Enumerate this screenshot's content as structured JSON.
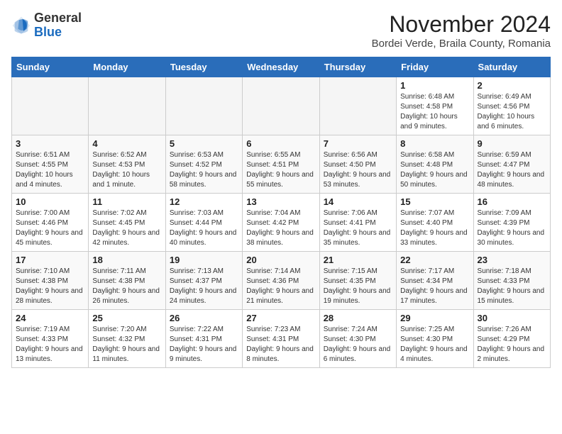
{
  "logo": {
    "general": "General",
    "blue": "Blue"
  },
  "title": "November 2024",
  "subtitle": "Bordei Verde, Braila County, Romania",
  "days_of_week": [
    "Sunday",
    "Monday",
    "Tuesday",
    "Wednesday",
    "Thursday",
    "Friday",
    "Saturday"
  ],
  "weeks": [
    [
      {
        "day": "",
        "info": ""
      },
      {
        "day": "",
        "info": ""
      },
      {
        "day": "",
        "info": ""
      },
      {
        "day": "",
        "info": ""
      },
      {
        "day": "",
        "info": ""
      },
      {
        "day": "1",
        "info": "Sunrise: 6:48 AM\nSunset: 4:58 PM\nDaylight: 10 hours and 9 minutes."
      },
      {
        "day": "2",
        "info": "Sunrise: 6:49 AM\nSunset: 4:56 PM\nDaylight: 10 hours and 6 minutes."
      }
    ],
    [
      {
        "day": "3",
        "info": "Sunrise: 6:51 AM\nSunset: 4:55 PM\nDaylight: 10 hours and 4 minutes."
      },
      {
        "day": "4",
        "info": "Sunrise: 6:52 AM\nSunset: 4:53 PM\nDaylight: 10 hours and 1 minute."
      },
      {
        "day": "5",
        "info": "Sunrise: 6:53 AM\nSunset: 4:52 PM\nDaylight: 9 hours and 58 minutes."
      },
      {
        "day": "6",
        "info": "Sunrise: 6:55 AM\nSunset: 4:51 PM\nDaylight: 9 hours and 55 minutes."
      },
      {
        "day": "7",
        "info": "Sunrise: 6:56 AM\nSunset: 4:50 PM\nDaylight: 9 hours and 53 minutes."
      },
      {
        "day": "8",
        "info": "Sunrise: 6:58 AM\nSunset: 4:48 PM\nDaylight: 9 hours and 50 minutes."
      },
      {
        "day": "9",
        "info": "Sunrise: 6:59 AM\nSunset: 4:47 PM\nDaylight: 9 hours and 48 minutes."
      }
    ],
    [
      {
        "day": "10",
        "info": "Sunrise: 7:00 AM\nSunset: 4:46 PM\nDaylight: 9 hours and 45 minutes."
      },
      {
        "day": "11",
        "info": "Sunrise: 7:02 AM\nSunset: 4:45 PM\nDaylight: 9 hours and 42 minutes."
      },
      {
        "day": "12",
        "info": "Sunrise: 7:03 AM\nSunset: 4:44 PM\nDaylight: 9 hours and 40 minutes."
      },
      {
        "day": "13",
        "info": "Sunrise: 7:04 AM\nSunset: 4:42 PM\nDaylight: 9 hours and 38 minutes."
      },
      {
        "day": "14",
        "info": "Sunrise: 7:06 AM\nSunset: 4:41 PM\nDaylight: 9 hours and 35 minutes."
      },
      {
        "day": "15",
        "info": "Sunrise: 7:07 AM\nSunset: 4:40 PM\nDaylight: 9 hours and 33 minutes."
      },
      {
        "day": "16",
        "info": "Sunrise: 7:09 AM\nSunset: 4:39 PM\nDaylight: 9 hours and 30 minutes."
      }
    ],
    [
      {
        "day": "17",
        "info": "Sunrise: 7:10 AM\nSunset: 4:38 PM\nDaylight: 9 hours and 28 minutes."
      },
      {
        "day": "18",
        "info": "Sunrise: 7:11 AM\nSunset: 4:38 PM\nDaylight: 9 hours and 26 minutes."
      },
      {
        "day": "19",
        "info": "Sunrise: 7:13 AM\nSunset: 4:37 PM\nDaylight: 9 hours and 24 minutes."
      },
      {
        "day": "20",
        "info": "Sunrise: 7:14 AM\nSunset: 4:36 PM\nDaylight: 9 hours and 21 minutes."
      },
      {
        "day": "21",
        "info": "Sunrise: 7:15 AM\nSunset: 4:35 PM\nDaylight: 9 hours and 19 minutes."
      },
      {
        "day": "22",
        "info": "Sunrise: 7:17 AM\nSunset: 4:34 PM\nDaylight: 9 hours and 17 minutes."
      },
      {
        "day": "23",
        "info": "Sunrise: 7:18 AM\nSunset: 4:33 PM\nDaylight: 9 hours and 15 minutes."
      }
    ],
    [
      {
        "day": "24",
        "info": "Sunrise: 7:19 AM\nSunset: 4:33 PM\nDaylight: 9 hours and 13 minutes."
      },
      {
        "day": "25",
        "info": "Sunrise: 7:20 AM\nSunset: 4:32 PM\nDaylight: 9 hours and 11 minutes."
      },
      {
        "day": "26",
        "info": "Sunrise: 7:22 AM\nSunset: 4:31 PM\nDaylight: 9 hours and 9 minutes."
      },
      {
        "day": "27",
        "info": "Sunrise: 7:23 AM\nSunset: 4:31 PM\nDaylight: 9 hours and 8 minutes."
      },
      {
        "day": "28",
        "info": "Sunrise: 7:24 AM\nSunset: 4:30 PM\nDaylight: 9 hours and 6 minutes."
      },
      {
        "day": "29",
        "info": "Sunrise: 7:25 AM\nSunset: 4:30 PM\nDaylight: 9 hours and 4 minutes."
      },
      {
        "day": "30",
        "info": "Sunrise: 7:26 AM\nSunset: 4:29 PM\nDaylight: 9 hours and 2 minutes."
      }
    ]
  ]
}
